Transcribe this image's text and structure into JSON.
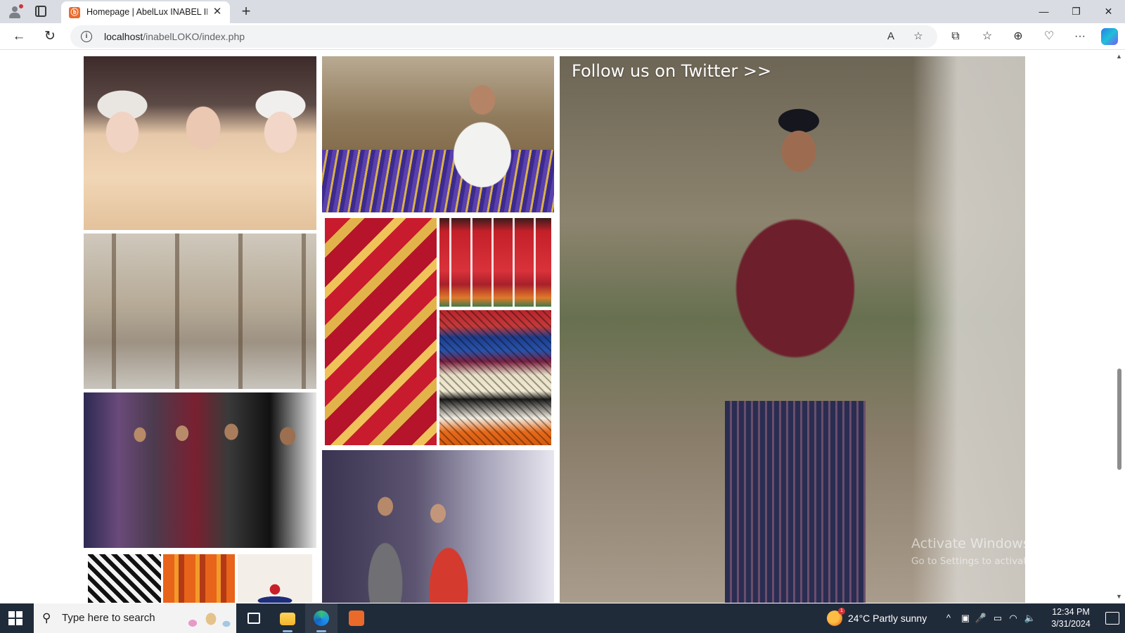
{
  "browser": {
    "tab": {
      "favicon": "abellux-logo-icon",
      "title": "Homepage | AbelLux INABEL ILO",
      "close": "✕"
    },
    "new_tab": "+",
    "window_controls": {
      "minimize": "—",
      "maximize": "❐",
      "close": "✕"
    },
    "nav": {
      "back": "←",
      "reload": "↻"
    },
    "address": {
      "info": "i",
      "host": "localhost",
      "path": "/inabelLOKO/index.php"
    },
    "address_icons": {
      "read_aloud": "A",
      "favorite": "☆"
    },
    "toolbar": {
      "split": "⧉",
      "favorites": "☆",
      "collections": "⊕",
      "performance": "♡",
      "more": "···"
    }
  },
  "page": {
    "twitter_link": "Follow us on Twitter >>",
    "images": {
      "elders": "Smiling elderly women",
      "weaver_elder": "Elderly weaver at loom",
      "looms": "Weavers working at looms",
      "textile_diamond": "Red and gold diamond textile",
      "textile_figures": "Red textile with figures",
      "textile_stack": "Stacked woven textiles",
      "runway_group": "Models in line on runway",
      "runway_couple": "Couple on runway",
      "pattern_1": "Black and white pattern",
      "pattern_2": "Orange striped pattern",
      "pattern_3": "White embroidered fabric",
      "model": "Male model in striped outfit"
    },
    "watermark": {
      "title": "Activate Windows",
      "subtitle": "Go to Settings to activate Windows."
    }
  },
  "scrollbar": {
    "up": "▲",
    "down": "▼"
  },
  "taskbar": {
    "search_placeholder": "Type here to search",
    "weather": {
      "badge": "1",
      "text": "24°C  Partly sunny"
    },
    "tray": {
      "chevron": "^",
      "meet": "▣",
      "mic": "🎤",
      "battery": "▭",
      "wifi": "◠",
      "volume": "🔈"
    },
    "clock": {
      "time": "12:34 PM",
      "date": "3/31/2024"
    }
  },
  "colors": {
    "tabbar": "#d9dde3",
    "taskbar": "#202b3a",
    "accent": "#ea6a2a"
  }
}
